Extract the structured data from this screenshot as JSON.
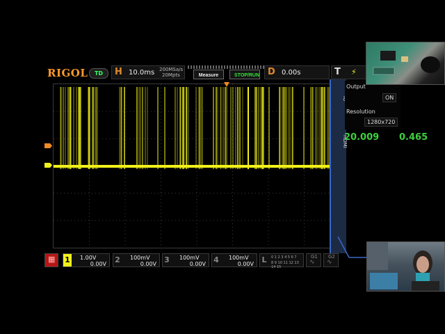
{
  "brand": {
    "logo_text": "RIGOL",
    "badge": "TD"
  },
  "header": {
    "horizontal_letter": "H",
    "timebase": "10.0ms",
    "sample_rate": "200MSa/s",
    "memory_depth": "20Mpts",
    "delay_letter": "D",
    "delay": "0.00s",
    "trigger_letter": "T"
  },
  "buttons": {
    "measure": "Measure",
    "stop_run": "STOP/RUN"
  },
  "side_panel": {
    "tab_io": "IO",
    "tab_hdmi": "HDMI",
    "output_title": "Output",
    "output_value": "ON",
    "resolution_title": "Resolution",
    "resolution_value": "1280x720"
  },
  "readouts": {
    "left": "20.009",
    "right": "0.465"
  },
  "channels": [
    {
      "num": "1",
      "scale": "1.00V",
      "offset": "0.00V"
    },
    {
      "num": "2",
      "scale": "100mV",
      "offset": "0.00V"
    },
    {
      "num": "3",
      "scale": "100mV",
      "offset": "0.00V"
    },
    {
      "num": "4",
      "scale": "100mV",
      "offset": "0.00V"
    }
  ],
  "logic": {
    "letter": "L",
    "row1": "0 1 2 3  4 5 6 7",
    "row2": "8 9 10 11 12 13 14 15"
  },
  "bus": {
    "g1": "G1",
    "g2": "G2"
  },
  "markers": {
    "ch1": "1",
    "trigger": "T"
  },
  "colors": {
    "ch1": "#f2f21a",
    "grid": "#3b3b3b",
    "trigger": "#f08a24",
    "side_panel": "#1c2a44"
  }
}
